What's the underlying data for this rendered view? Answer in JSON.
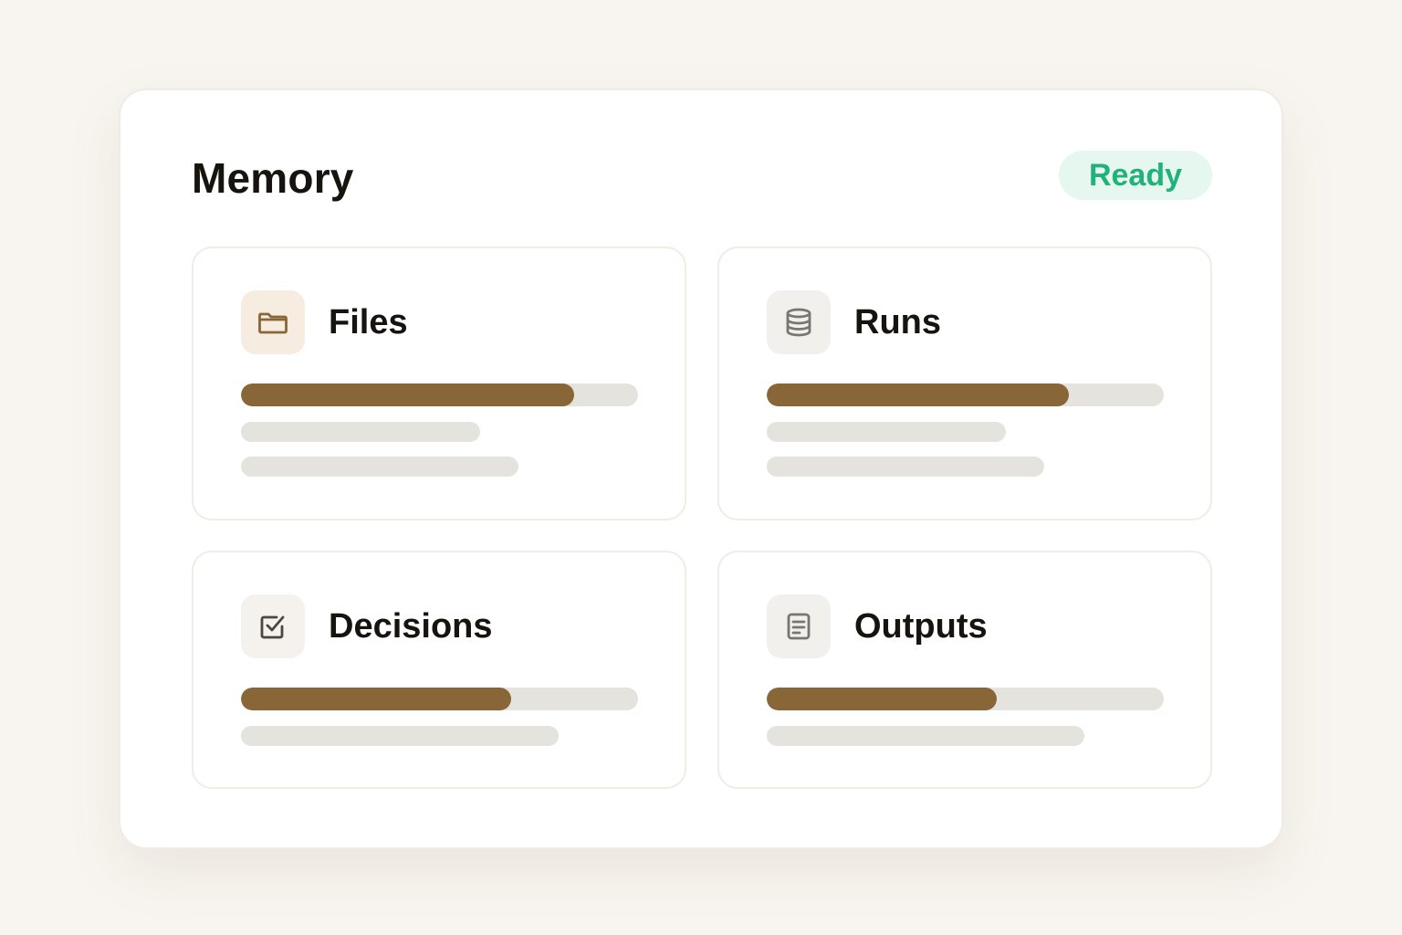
{
  "panel": {
    "title": "Memory",
    "status": "Ready"
  },
  "cards": [
    {
      "label": "Files",
      "icon": "folder-icon",
      "progress": 0.84
    },
    {
      "label": "Runs",
      "icon": "database-icon",
      "progress": 0.76
    },
    {
      "label": "Decisions",
      "icon": "checkbox-icon",
      "progress": 0.68
    },
    {
      "label": "Outputs",
      "icon": "document-icon",
      "progress": 0.58
    }
  ],
  "colors": {
    "accent": "#886638",
    "track": "#e5e3de",
    "status_text": "#20b27a",
    "status_bg": "#e6f7ef",
    "background": "#f8f5f0"
  }
}
